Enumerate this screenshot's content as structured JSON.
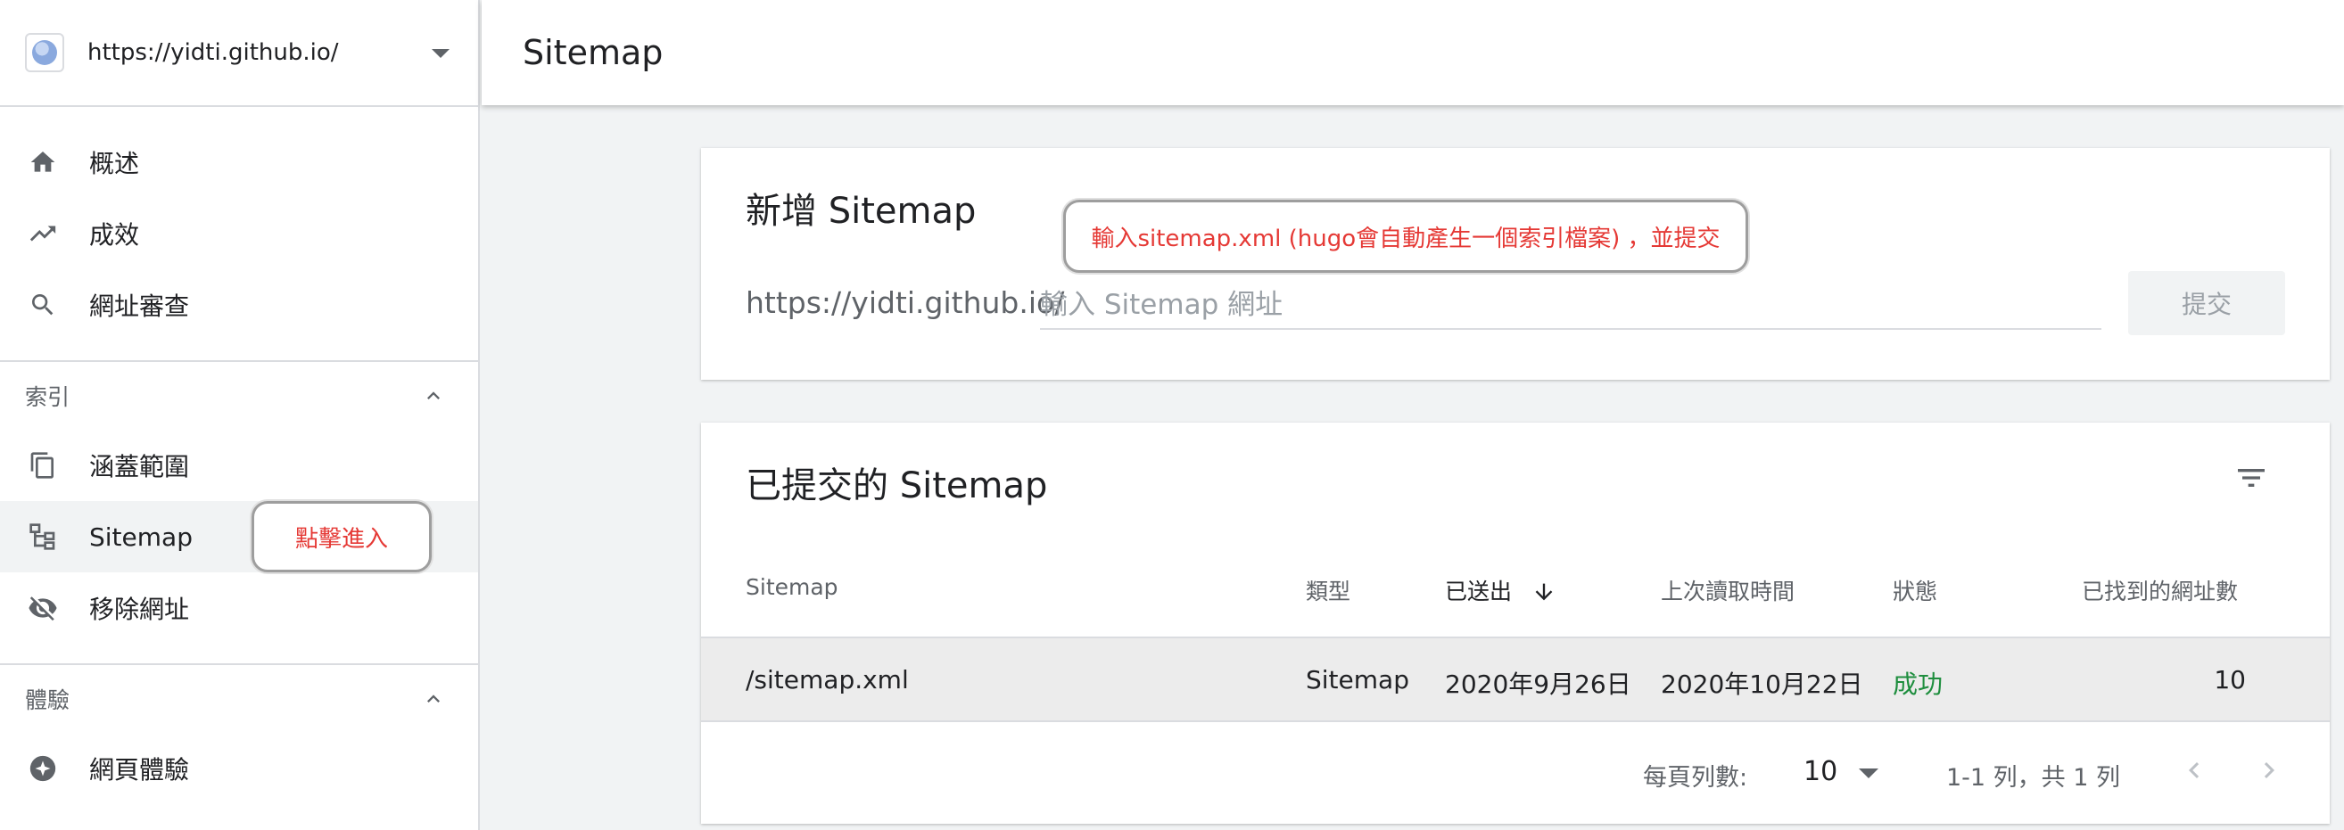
{
  "property": {
    "url": "https://yidti.github.io/"
  },
  "sidebar": {
    "top_items": [
      {
        "label": "概述",
        "icon": "home-icon"
      },
      {
        "label": "成效",
        "icon": "trending-up-icon"
      },
      {
        "label": "網址審查",
        "icon": "search-icon"
      }
    ],
    "index_section": {
      "title": "索引",
      "items": [
        {
          "label": "涵蓋範圍",
          "icon": "copy-pages-icon"
        },
        {
          "label": "Sitemap",
          "icon": "sitemap-icon",
          "active": true
        },
        {
          "label": "移除網址",
          "icon": "eye-off-icon"
        }
      ]
    },
    "experience_section": {
      "title": "體驗",
      "items": [
        {
          "label": "網頁體驗",
          "icon": "page-experience-icon"
        }
      ]
    }
  },
  "header": {
    "title": "Sitemap"
  },
  "add_sitemap": {
    "title": "新增 Sitemap",
    "url_prefix": "https://yidti.github.io/",
    "input_placeholder": "輸入 Sitemap 網址",
    "input_value": "",
    "submit_label": "提交"
  },
  "submitted": {
    "title": "已提交的 Sitemap",
    "columns": [
      "Sitemap",
      "類型",
      "已送出",
      "上次讀取時間",
      "狀態",
      "已找到的網址數"
    ],
    "sorted_column": "已送出",
    "rows": [
      {
        "sitemap": "/sitemap.xml",
        "type": "Sitemap",
        "submitted": "2020年9月26日",
        "last_read": "2020年10月22日",
        "status": "成功",
        "urls_found": "10"
      }
    ],
    "pagination": {
      "rows_per_page_label": "每頁列數:",
      "rows_per_page": "10",
      "range_text": "1-1 列，共 1 列"
    }
  },
  "annotations": {
    "top": "輸入sitemap.xml (hugo會自動產生一個索引檔案) ，並提交",
    "side": "點擊進入"
  },
  "colors": {
    "success": "#1e8e3e",
    "annotation_text": "#e53935",
    "active_bg": "#f1f3f4"
  }
}
